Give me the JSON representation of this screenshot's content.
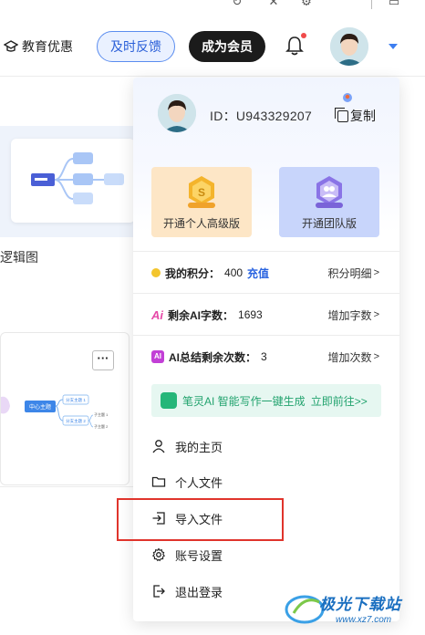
{
  "header": {
    "edu_label": "教育优惠",
    "feedback_label": "及时反馈",
    "vip_label": "成为会员"
  },
  "background": {
    "card1_label": "逻辑图",
    "mindmap_center": "中心主题",
    "mindmap_branch_1": "分支主题 1",
    "mindmap_branch_2": "分支主题 2",
    "mindmap_sub_1": "子主题 1",
    "mindmap_sub_2": "子主题 2",
    "more_label": "···"
  },
  "panel": {
    "user_id": "ID：U943329207",
    "copy_label": "复制",
    "plans": [
      {
        "label": "开通个人高级版",
        "color": "#fde6c6"
      },
      {
        "label": "开通团队版",
        "color": "#c8d5fb"
      }
    ],
    "points": {
      "label": "我的积分：",
      "value": "400",
      "recharge": "充值",
      "link": "积分明细"
    },
    "ai_words": {
      "label": "剩余AI字数：",
      "value": "1693",
      "link": "增加字数"
    },
    "ai_summary": {
      "label": "AI总结剩余次数：",
      "value": "3",
      "link": "增加次数"
    },
    "promo": {
      "text": "笔灵AI 智能写作一键生成",
      "cta": "立即前往>>"
    },
    "menu": [
      {
        "label": "我的主页",
        "icon": "user-icon"
      },
      {
        "label": "个人文件",
        "icon": "folder-icon"
      },
      {
        "label": "导入文件",
        "icon": "import-icon"
      },
      {
        "label": "账号设置",
        "icon": "gear-icon"
      },
      {
        "label": "退出登录",
        "icon": "logout-icon"
      }
    ]
  },
  "watermark": {
    "text": "极光下载站",
    "url": "www.xz7.com"
  },
  "colors": {
    "accent": "#2a64e0",
    "vip_bg": "#1b1b1b",
    "highlight": "#e0342c",
    "promo_green": "#22a36e"
  }
}
